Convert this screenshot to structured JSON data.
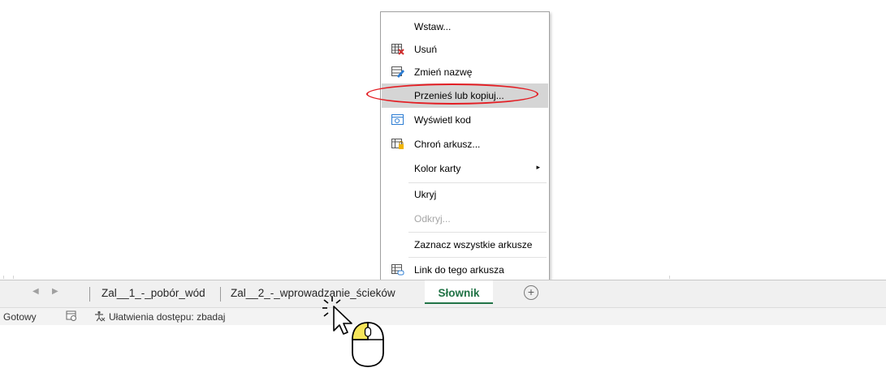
{
  "context_menu": {
    "items": [
      {
        "label": "Wstaw...",
        "icon": ""
      },
      {
        "label": "Usuń",
        "icon": "delete-sheet-icon"
      },
      {
        "label": "Zmień nazwę",
        "icon": "rename-sheet-icon"
      },
      {
        "label": "Przenieś lub kopiuj...",
        "icon": "",
        "highlighted": true
      },
      {
        "label": "Wyświetl kod",
        "icon": "view-code-icon"
      },
      {
        "label": "Chroń arkusz...",
        "icon": "protect-sheet-icon"
      },
      {
        "label": "Kolor karty",
        "icon": "",
        "submenu": "▸"
      },
      {
        "label": "Ukryj",
        "icon": ""
      },
      {
        "label": "Odkryj...",
        "icon": "",
        "disabled": true
      },
      {
        "label": "Zaznacz wszystkie arkusze",
        "icon": ""
      },
      {
        "label": "Link do tego arkusza",
        "icon": "link-sheet-icon"
      }
    ]
  },
  "tabbar": {
    "prev_arrow": "◀",
    "next_arrow": "▶",
    "tabs": [
      {
        "label": "Zal__1_-_pobór_wód",
        "active": false
      },
      {
        "label": "Zal__2_-_wprowadzanie_ścieków",
        "active": false
      },
      {
        "label": "Słownik",
        "active": true
      }
    ],
    "add_sheet": "+"
  },
  "statusbar": {
    "ready": "Gotowy",
    "accessibility": "Ułatwienia dostępu: zbadaj"
  },
  "colors": {
    "accent": "#217346",
    "highlight_oval": "#e31e24",
    "menu_hover": "#d5d5d5"
  }
}
